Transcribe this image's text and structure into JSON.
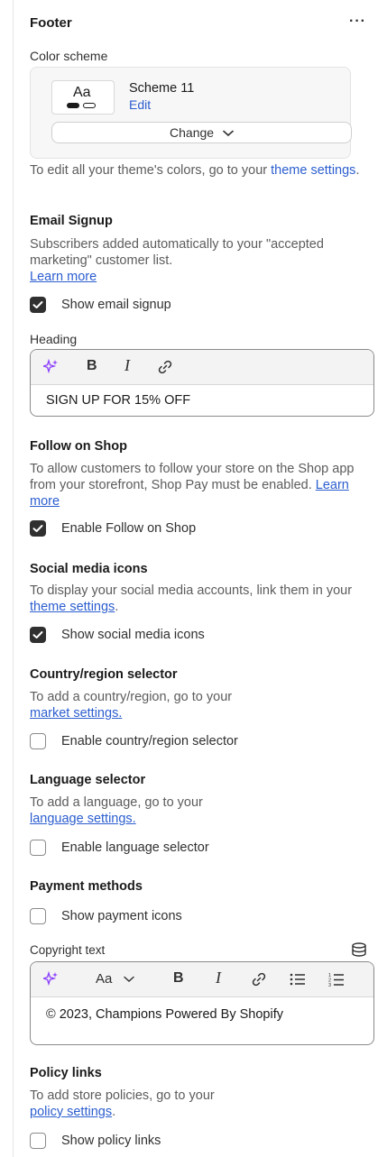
{
  "header": {
    "title": "Footer",
    "more_label": "···"
  },
  "color_scheme": {
    "label": "Color scheme",
    "preview_text": "Aa",
    "name": "Scheme 11",
    "edit_label": "Edit",
    "change_label": "Change",
    "help_prefix": "To edit all your theme's colors, go to your",
    "help_link": "theme settings",
    "help_suffix": "."
  },
  "email_signup": {
    "heading": "Email Signup",
    "help": "Subscribers added automatically to your \"accepted marketing\" customer list.",
    "link": "Learn more",
    "checkbox_label": "Show email signup",
    "checked": true,
    "field_label": "Heading",
    "field_value": "SIGN UP FOR 15% OFF"
  },
  "follow_on_shop": {
    "heading": "Follow on Shop",
    "help": "To allow customers to follow your store on the Shop app from your storefront, Shop Pay must be enabled.",
    "link": "Learn more",
    "checkbox_label": "Enable Follow on Shop",
    "checked": true
  },
  "social_media": {
    "heading": "Social media icons",
    "help_prefix": "To display your social media accounts, link them in your",
    "link": "theme settings",
    "help_suffix": ".",
    "checkbox_label": "Show social media icons",
    "checked": true
  },
  "country_selector": {
    "heading": "Country/region selector",
    "help": "To add a country/region, go to your",
    "link": "market settings.",
    "checkbox_label": "Enable country/region selector",
    "checked": false
  },
  "language_selector": {
    "heading": "Language selector",
    "help": "To add a language, go to your",
    "link": "language settings.",
    "checkbox_label": "Enable language selector",
    "checked": false
  },
  "payment_methods": {
    "heading": "Payment methods",
    "checkbox_label": "Show payment icons",
    "checked": false
  },
  "copyright": {
    "label": "Copyright text",
    "value": "© 2023, Champions Powered By Shopify",
    "font_menu_label": "Aa"
  },
  "policy_links": {
    "heading": "Policy links",
    "help": "To add store policies, go to your",
    "link": "policy settings",
    "help_suffix": ".",
    "checkbox_label": "Show policy links",
    "checked": false
  }
}
